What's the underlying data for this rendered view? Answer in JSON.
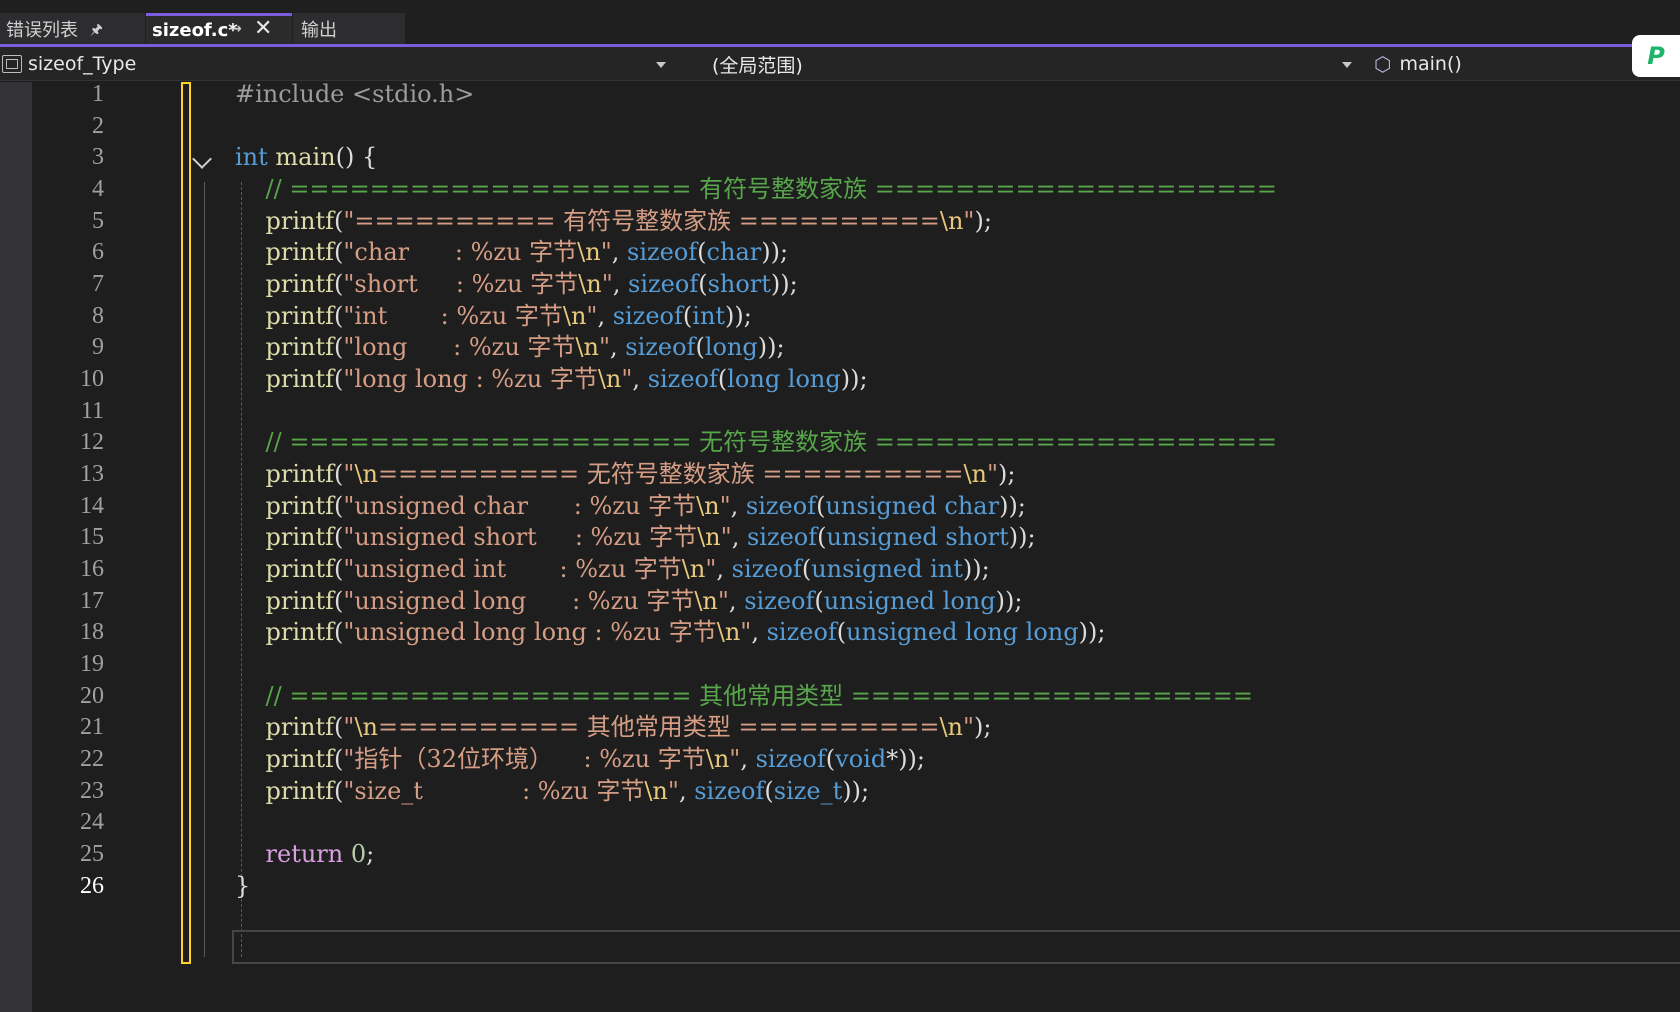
{
  "tabs": {
    "errors_label": "错误列表",
    "active_label": "sizeof.c*",
    "output_label": "输出"
  },
  "navbar": {
    "project": "sizeof_Type",
    "scope": "(全局范围)",
    "function": "main()"
  },
  "editor": {
    "current_line": 26,
    "line_numbers": [
      "1",
      "2",
      "3",
      "4",
      "5",
      "6",
      "7",
      "8",
      "9",
      "10",
      "11",
      "12",
      "13",
      "14",
      "15",
      "16",
      "17",
      "18",
      "19",
      "20",
      "21",
      "22",
      "23",
      "24",
      "25",
      "26"
    ],
    "lines": [
      [
        {
          "t": "pp",
          "v": "#include <stdio.h>"
        }
      ],
      [],
      [
        {
          "t": "kw",
          "v": "int"
        },
        {
          "t": "n",
          "v": " "
        },
        {
          "t": "fn",
          "v": "main"
        },
        {
          "t": "n",
          "v": "() {"
        }
      ],
      [
        {
          "t": "n",
          "v": "    "
        },
        {
          "t": "cm",
          "v": "// ==================== 有符号整数家族 ===================="
        }
      ],
      [
        {
          "t": "n",
          "v": "    "
        },
        {
          "t": "fn",
          "v": "printf"
        },
        {
          "t": "n",
          "v": "("
        },
        {
          "t": "str",
          "v": "\"========== 有符号整数家族 =========="
        },
        {
          "t": "esc",
          "v": "\\n"
        },
        {
          "t": "str",
          "v": "\""
        },
        {
          "t": "n",
          "v": ");"
        }
      ],
      [
        {
          "t": "n",
          "v": "    "
        },
        {
          "t": "fn",
          "v": "printf"
        },
        {
          "t": "n",
          "v": "("
        },
        {
          "t": "str",
          "v": "\"char      : %zu 字节"
        },
        {
          "t": "esc",
          "v": "\\n"
        },
        {
          "t": "str",
          "v": "\""
        },
        {
          "t": "n",
          "v": ", "
        },
        {
          "t": "kw",
          "v": "sizeof"
        },
        {
          "t": "n",
          "v": "("
        },
        {
          "t": "kw",
          "v": "char"
        },
        {
          "t": "n",
          "v": "));"
        }
      ],
      [
        {
          "t": "n",
          "v": "    "
        },
        {
          "t": "fn",
          "v": "printf"
        },
        {
          "t": "n",
          "v": "("
        },
        {
          "t": "str",
          "v": "\"short     : %zu 字节"
        },
        {
          "t": "esc",
          "v": "\\n"
        },
        {
          "t": "str",
          "v": "\""
        },
        {
          "t": "n",
          "v": ", "
        },
        {
          "t": "kw",
          "v": "sizeof"
        },
        {
          "t": "n",
          "v": "("
        },
        {
          "t": "kw",
          "v": "short"
        },
        {
          "t": "n",
          "v": "));"
        }
      ],
      [
        {
          "t": "n",
          "v": "    "
        },
        {
          "t": "fn",
          "v": "printf"
        },
        {
          "t": "n",
          "v": "("
        },
        {
          "t": "str",
          "v": "\"int       : %zu 字节"
        },
        {
          "t": "esc",
          "v": "\\n"
        },
        {
          "t": "str",
          "v": "\""
        },
        {
          "t": "n",
          "v": ", "
        },
        {
          "t": "kw",
          "v": "sizeof"
        },
        {
          "t": "n",
          "v": "("
        },
        {
          "t": "kw",
          "v": "int"
        },
        {
          "t": "n",
          "v": "));"
        }
      ],
      [
        {
          "t": "n",
          "v": "    "
        },
        {
          "t": "fn",
          "v": "printf"
        },
        {
          "t": "n",
          "v": "("
        },
        {
          "t": "str",
          "v": "\"long      : %zu 字节"
        },
        {
          "t": "esc",
          "v": "\\n"
        },
        {
          "t": "str",
          "v": "\""
        },
        {
          "t": "n",
          "v": ", "
        },
        {
          "t": "kw",
          "v": "sizeof"
        },
        {
          "t": "n",
          "v": "("
        },
        {
          "t": "kw",
          "v": "long"
        },
        {
          "t": "n",
          "v": "));"
        }
      ],
      [
        {
          "t": "n",
          "v": "    "
        },
        {
          "t": "fn",
          "v": "printf"
        },
        {
          "t": "n",
          "v": "("
        },
        {
          "t": "str",
          "v": "\"long long : %zu 字节"
        },
        {
          "t": "esc",
          "v": "\\n"
        },
        {
          "t": "str",
          "v": "\""
        },
        {
          "t": "n",
          "v": ", "
        },
        {
          "t": "kw",
          "v": "sizeof"
        },
        {
          "t": "n",
          "v": "("
        },
        {
          "t": "kw",
          "v": "long long"
        },
        {
          "t": "n",
          "v": "));"
        }
      ],
      [],
      [
        {
          "t": "n",
          "v": "    "
        },
        {
          "t": "cm",
          "v": "// ==================== 无符号整数家族 ===================="
        }
      ],
      [
        {
          "t": "n",
          "v": "    "
        },
        {
          "t": "fn",
          "v": "printf"
        },
        {
          "t": "n",
          "v": "("
        },
        {
          "t": "str",
          "v": "\""
        },
        {
          "t": "esc",
          "v": "\\n"
        },
        {
          "t": "str",
          "v": "========== 无符号整数家族 =========="
        },
        {
          "t": "esc",
          "v": "\\n"
        },
        {
          "t": "str",
          "v": "\""
        },
        {
          "t": "n",
          "v": ");"
        }
      ],
      [
        {
          "t": "n",
          "v": "    "
        },
        {
          "t": "fn",
          "v": "printf"
        },
        {
          "t": "n",
          "v": "("
        },
        {
          "t": "str",
          "v": "\"unsigned char      : %zu 字节"
        },
        {
          "t": "esc",
          "v": "\\n"
        },
        {
          "t": "str",
          "v": "\""
        },
        {
          "t": "n",
          "v": ", "
        },
        {
          "t": "kw",
          "v": "sizeof"
        },
        {
          "t": "n",
          "v": "("
        },
        {
          "t": "kw",
          "v": "unsigned char"
        },
        {
          "t": "n",
          "v": "));"
        }
      ],
      [
        {
          "t": "n",
          "v": "    "
        },
        {
          "t": "fn",
          "v": "printf"
        },
        {
          "t": "n",
          "v": "("
        },
        {
          "t": "str",
          "v": "\"unsigned short     : %zu 字节"
        },
        {
          "t": "esc",
          "v": "\\n"
        },
        {
          "t": "str",
          "v": "\""
        },
        {
          "t": "n",
          "v": ", "
        },
        {
          "t": "kw",
          "v": "sizeof"
        },
        {
          "t": "n",
          "v": "("
        },
        {
          "t": "kw",
          "v": "unsigned short"
        },
        {
          "t": "n",
          "v": "));"
        }
      ],
      [
        {
          "t": "n",
          "v": "    "
        },
        {
          "t": "fn",
          "v": "printf"
        },
        {
          "t": "n",
          "v": "("
        },
        {
          "t": "str",
          "v": "\"unsigned int       : %zu 字节"
        },
        {
          "t": "esc",
          "v": "\\n"
        },
        {
          "t": "str",
          "v": "\""
        },
        {
          "t": "n",
          "v": ", "
        },
        {
          "t": "kw",
          "v": "sizeof"
        },
        {
          "t": "n",
          "v": "("
        },
        {
          "t": "kw",
          "v": "unsigned int"
        },
        {
          "t": "n",
          "v": "));"
        }
      ],
      [
        {
          "t": "n",
          "v": "    "
        },
        {
          "t": "fn",
          "v": "printf"
        },
        {
          "t": "n",
          "v": "("
        },
        {
          "t": "str",
          "v": "\"unsigned long      : %zu 字节"
        },
        {
          "t": "esc",
          "v": "\\n"
        },
        {
          "t": "str",
          "v": "\""
        },
        {
          "t": "n",
          "v": ", "
        },
        {
          "t": "kw",
          "v": "sizeof"
        },
        {
          "t": "n",
          "v": "("
        },
        {
          "t": "kw",
          "v": "unsigned long"
        },
        {
          "t": "n",
          "v": "));"
        }
      ],
      [
        {
          "t": "n",
          "v": "    "
        },
        {
          "t": "fn",
          "v": "printf"
        },
        {
          "t": "n",
          "v": "("
        },
        {
          "t": "str",
          "v": "\"unsigned long long : %zu 字节"
        },
        {
          "t": "esc",
          "v": "\\n"
        },
        {
          "t": "str",
          "v": "\""
        },
        {
          "t": "n",
          "v": ", "
        },
        {
          "t": "kw",
          "v": "sizeof"
        },
        {
          "t": "n",
          "v": "("
        },
        {
          "t": "kw",
          "v": "unsigned long long"
        },
        {
          "t": "n",
          "v": "));"
        }
      ],
      [],
      [
        {
          "t": "n",
          "v": "    "
        },
        {
          "t": "cm",
          "v": "// ==================== 其他常用类型 ===================="
        }
      ],
      [
        {
          "t": "n",
          "v": "    "
        },
        {
          "t": "fn",
          "v": "printf"
        },
        {
          "t": "n",
          "v": "("
        },
        {
          "t": "str",
          "v": "\""
        },
        {
          "t": "esc",
          "v": "\\n"
        },
        {
          "t": "str",
          "v": "========== 其他常用类型 =========="
        },
        {
          "t": "esc",
          "v": "\\n"
        },
        {
          "t": "str",
          "v": "\""
        },
        {
          "t": "n",
          "v": ");"
        }
      ],
      [
        {
          "t": "n",
          "v": "    "
        },
        {
          "t": "fn",
          "v": "printf"
        },
        {
          "t": "n",
          "v": "("
        },
        {
          "t": "str",
          "v": "\"指针（32位环境）    : %zu 字节"
        },
        {
          "t": "esc",
          "v": "\\n"
        },
        {
          "t": "str",
          "v": "\""
        },
        {
          "t": "n",
          "v": ", "
        },
        {
          "t": "kw",
          "v": "sizeof"
        },
        {
          "t": "n",
          "v": "("
        },
        {
          "t": "kw",
          "v": "void"
        },
        {
          "t": "n",
          "v": "*));"
        }
      ],
      [
        {
          "t": "n",
          "v": "    "
        },
        {
          "t": "fn",
          "v": "printf"
        },
        {
          "t": "n",
          "v": "("
        },
        {
          "t": "str",
          "v": "\"size_t             : %zu 字节"
        },
        {
          "t": "esc",
          "v": "\\n"
        },
        {
          "t": "str",
          "v": "\""
        },
        {
          "t": "n",
          "v": ", "
        },
        {
          "t": "kw",
          "v": "sizeof"
        },
        {
          "t": "n",
          "v": "("
        },
        {
          "t": "kw",
          "v": "size_t"
        },
        {
          "t": "n",
          "v": "));"
        }
      ],
      [],
      [
        {
          "t": "n",
          "v": "    "
        },
        {
          "t": "ret",
          "v": "return"
        },
        {
          "t": "n",
          "v": " "
        },
        {
          "t": "num",
          "v": "0"
        },
        {
          "t": "n",
          "v": ";"
        }
      ],
      [
        {
          "t": "n",
          "v": "}"
        }
      ]
    ]
  },
  "colors": {
    "accent": "#7d5ce0",
    "change_marker": "#ffd32a",
    "keyword": "#569cd6",
    "function": "#dcdcaa",
    "string": "#d69d85",
    "comment": "#57a64a"
  },
  "icons": {
    "pin": "pin-icon",
    "close": "close-icon",
    "project": "project-icon",
    "function": "cube-icon",
    "extension": "extension-icon"
  }
}
